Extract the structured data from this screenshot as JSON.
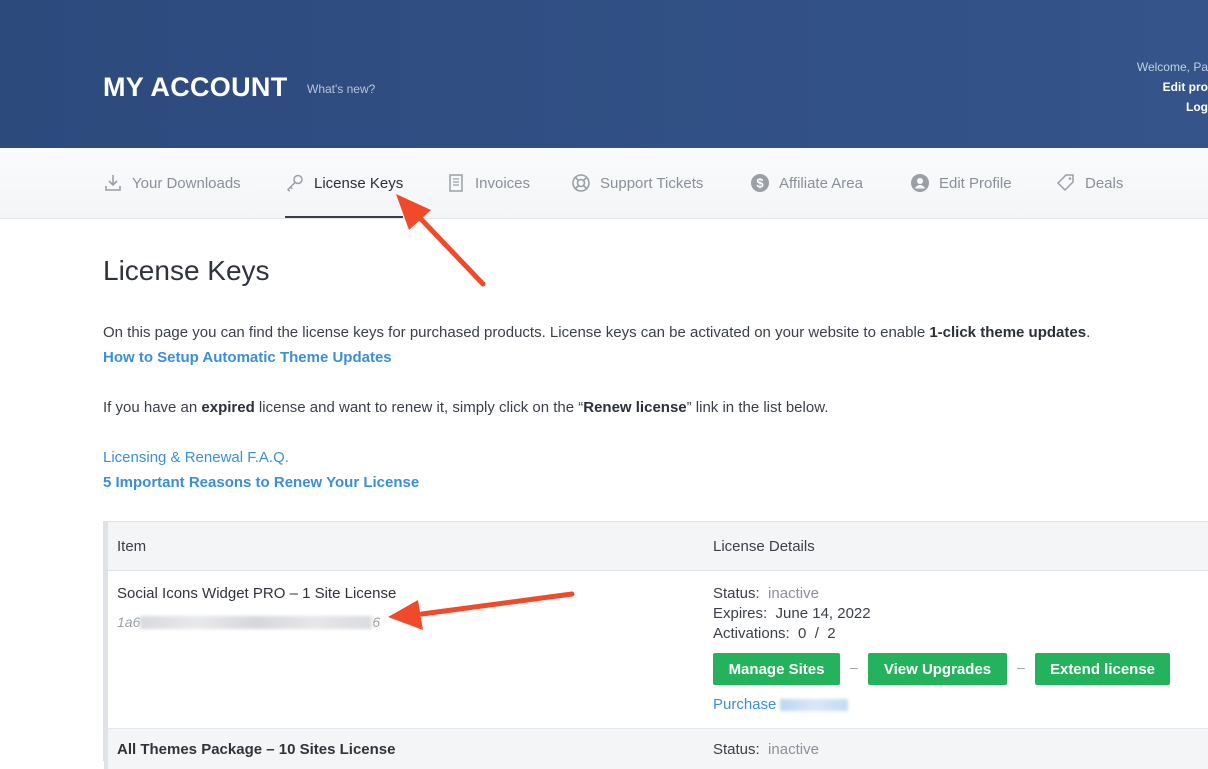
{
  "header": {
    "title": "MY ACCOUNT",
    "whats_new": "What's new?",
    "welcome": "Welcome, Pa",
    "edit_profile": "Edit pro",
    "logout": "Log"
  },
  "nav": {
    "items": [
      {
        "label": "Your Downloads",
        "icon": "download-icon"
      },
      {
        "label": "License Keys",
        "icon": "key-icon",
        "active": true
      },
      {
        "label": "Invoices",
        "icon": "invoice-icon"
      },
      {
        "label": "Support Tickets",
        "icon": "lifebuoy-icon"
      },
      {
        "label": "Affiliate Area",
        "icon": "dollar-icon"
      },
      {
        "label": "Edit Profile",
        "icon": "user-icon"
      },
      {
        "label": "Deals",
        "icon": "tag-icon"
      }
    ]
  },
  "main": {
    "title": "License Keys",
    "intro_pre": "On this page you can find the license keys for purchased products. License keys can be activated on your website to enable ",
    "intro_bold": "1-click theme updates",
    "intro_post": ".",
    "setup_link": "How to Setup Automatic Theme Updates",
    "expired_pre": "If you have an ",
    "expired_bold": "expired",
    "expired_mid": " license and want to renew it, simply click on the “",
    "expired_bold2": "Renew license",
    "expired_post": "” link in the list below.",
    "faq_link": "Licensing & Renewal F.A.Q.",
    "reasons_link": "5 Important Reasons to Renew Your License"
  },
  "table": {
    "col_item": "Item",
    "col_details": "License Details",
    "rows": [
      {
        "item": "Social Icons Widget PRO  –  1 Site License",
        "key_prefix": "1a6",
        "key_suffix": "6",
        "status_label": "Status:",
        "status_value": "inactive",
        "expires_label": "Expires:",
        "expires_value": "June 14, 2022",
        "activations_label": "Activations:",
        "activations_value": "0  /  2",
        "btn_manage": "Manage Sites",
        "btn_upgrades": "View Upgrades",
        "btn_extend": "Extend license",
        "separator": "–",
        "purchase_label": "Purchase"
      },
      {
        "item": "All Themes Package  –  10 Sites License",
        "status_label": "Status:",
        "status_value": "inactive"
      }
    ]
  },
  "colors": {
    "header_bg": "#2d4a7d",
    "link": "#3b8fd6",
    "button": "#24b35c",
    "arrow": "#f04a2a"
  }
}
